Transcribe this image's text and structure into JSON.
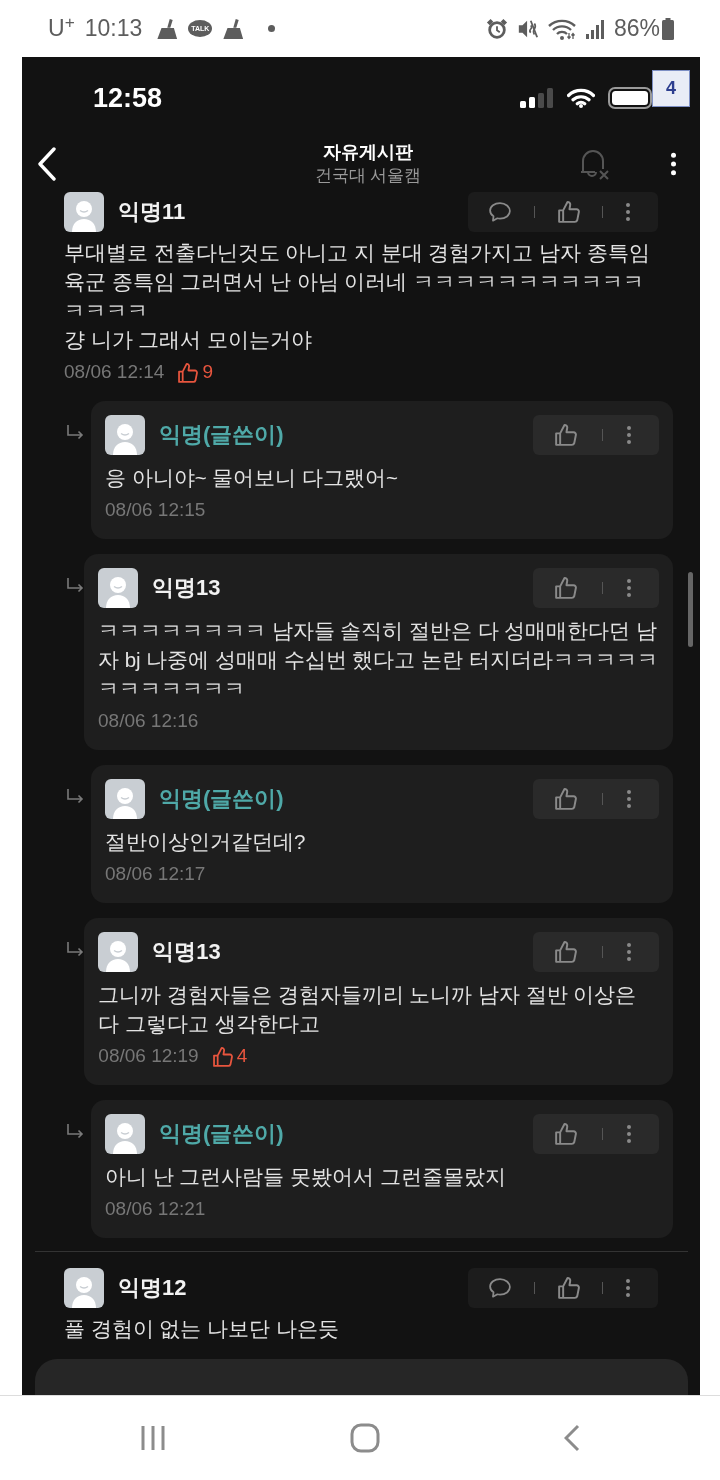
{
  "android_status_bar": {
    "carrier": "U$^{+}$",
    "time": "10:13",
    "notifications": [
      {
        "kind": "cleaner"
      },
      {
        "kind": "talk",
        "label": "TALK"
      },
      {
        "kind": "cleaner"
      },
      {
        "kind": "dot"
      }
    ],
    "battery": "86%"
  },
  "ios_status_bar": {
    "time": "12:58"
  },
  "page_badge": "4",
  "header": {
    "title": "자유게시판",
    "subtitle": "건국대 서울캠"
  },
  "comments": [
    {
      "author": "익명11",
      "op": false,
      "text": "부대별로 전출다닌것도 아니고 지 분대 경험가지고 남자 종특임 육군 종특임 그러면서 난 아님 이러네 ㅋㅋㅋㅋㅋㅋㅋㅋㅋㅋㅋㅋㅋㅋㅋ\n걍 니가 그래서 모이는거야",
      "time": "08/06 12:14",
      "likes": "9",
      "replies": [
        {
          "author": "익명(글쓴이)",
          "op": true,
          "text": "응 아니야~ 물어보니 다그랬어~",
          "time": "08/06 12:15"
        },
        {
          "author": "익명13",
          "op": false,
          "text": "ㅋㅋㅋㅋㅋㅋㅋㅋ 남자들 솔직히 절반은 다 성매매한다던 남자 bj 나중에 성매매 수십번 했다고 논란 터지더라ㅋㅋㅋㅋㅋㅋㅋㅋㅋㅋㅋㅋ",
          "time": "08/06 12:16"
        },
        {
          "author": "익명(글쓴이)",
          "op": true,
          "text": "절반이상인거같던데?",
          "time": "08/06 12:17"
        },
        {
          "author": "익명13",
          "op": false,
          "text": "그니까 경험자들은 경험자들끼리 노니까 남자 절반 이상은 다 그렇다고 생각한다고",
          "time": "08/06 12:19",
          "likes": "4"
        },
        {
          "author": "익명(글쓴이)",
          "op": true,
          "text": "아니 난 그런사람들 못봤어서 그런줄몰랐지",
          "time": "08/06 12:21"
        }
      ]
    },
    {
      "author": "익명12",
      "op": false,
      "text": "풀 경험이 없는 나보단 나은듯"
    }
  ]
}
